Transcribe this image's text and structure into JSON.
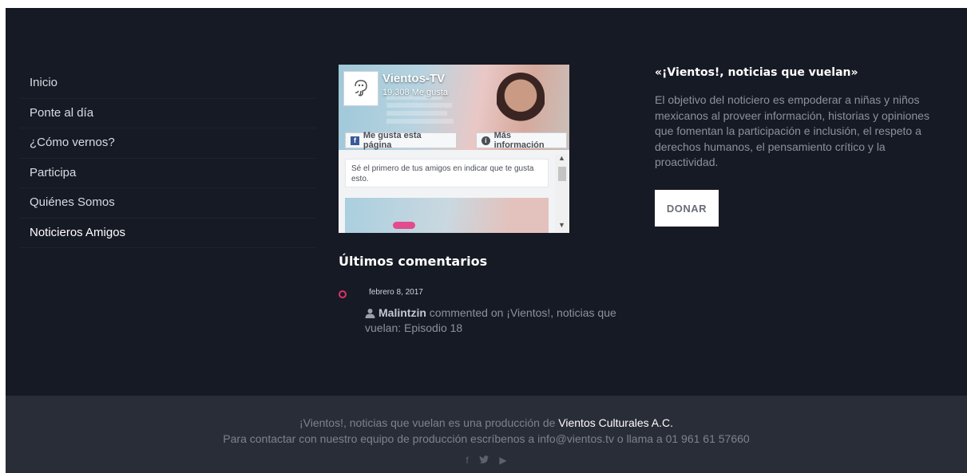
{
  "nav": {
    "items": [
      {
        "label": "Inicio"
      },
      {
        "label": "Ponte al día"
      },
      {
        "label": "¿Cómo vernos?"
      },
      {
        "label": "Participa"
      },
      {
        "label": "Quiénes Somos"
      },
      {
        "label": "Noticieros Amigos"
      }
    ],
    "active_index": 5
  },
  "fb_widget": {
    "page_name": "Vientos-TV",
    "likes": "19.308 Me gusta",
    "like_button": "Me gusta esta página",
    "info_button": "Más información",
    "friends_text": "Sé el primero de tus amigos en indicar que te gusta esto."
  },
  "comments": {
    "title": "Últimos comentarios",
    "items": [
      {
        "date": "febrero 8, 2017",
        "author": "Malintzin",
        "text": "commented on ¡Vientos!, noticias que vuelan: Episodio 18"
      }
    ]
  },
  "about": {
    "title": "«¡Vientos!, noticias que vuelan»",
    "text": "El objetivo del noticiero es empoderar a niñas y niños mexicanos al proveer información, historias y opiniones que fomentan la participación e inclusión, el respeto a derechos humanos, el pensamiento crítico y la proactividad.",
    "donate_label": "DONAR"
  },
  "footer": {
    "line1_prefix": "¡Vientos!, noticias que vuelan es una producción de",
    "line1_org": "Vientos Culturales A.C.",
    "line2": "Para contactar con nuestro equipo de producción escríbenos a info@vientos.tv o llama a 01 961 61 57660",
    "social_icons": [
      "facebook-icon",
      "twitter-icon",
      "youtube-icon"
    ]
  },
  "colors": {
    "background": "#161a24",
    "footer": "#292d37",
    "accent": "#e0306c"
  }
}
